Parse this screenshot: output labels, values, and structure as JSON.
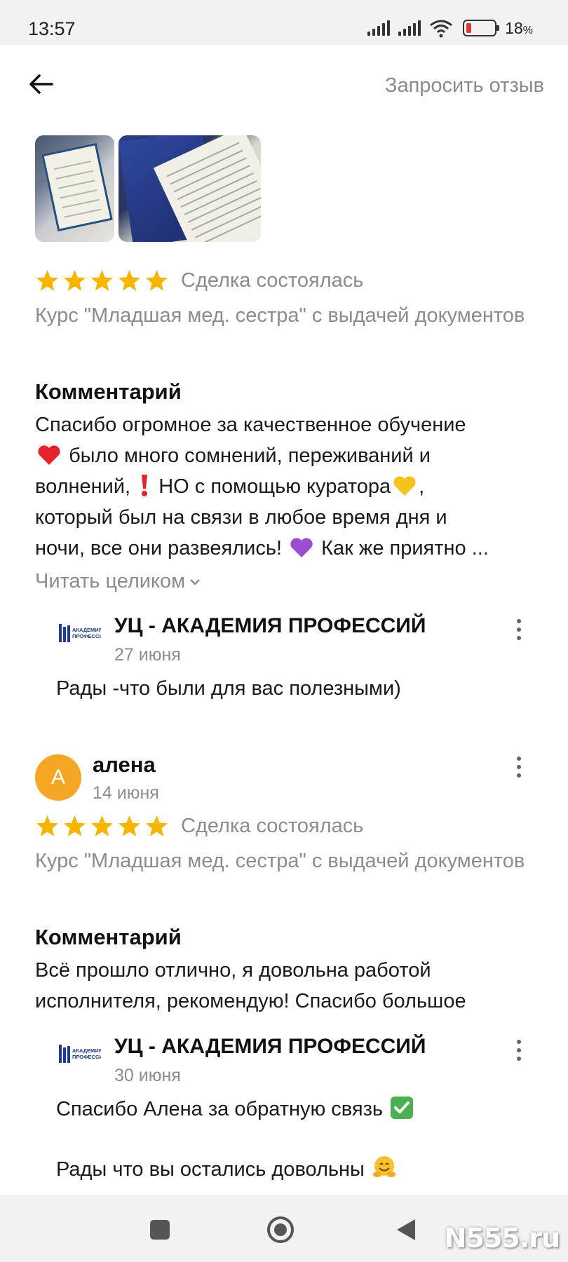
{
  "status_bar": {
    "time": "13:57",
    "battery_percent": 18,
    "battery_label": "18",
    "battery_unit": "%"
  },
  "header": {
    "request_review": "Запросить отзыв"
  },
  "reviews": [
    {
      "rating": 5,
      "deal_status": "Сделка состоялась",
      "course": "Курс \"Младшая мед. сестра\" с выдачей документов",
      "comment_heading": "Комментарий",
      "comment_lines": [
        "Спасибо огромное за качественное обучение",
        "было много сомнений, переживаний и",
        "волнений,",
        "НО с помощью куратора",
        ",",
        "который был на связи в любое время дня и",
        "ночи, все они развеялись!",
        "Как же приятно ..."
      ],
      "read_more": "Читать целиком",
      "reply": {
        "name": "УЦ -  АКАДЕМИЯ ПРОФЕССИЙ",
        "date": "27 июня",
        "text": "Рады -что были для вас полезными)"
      }
    },
    {
      "author": {
        "initial": "А",
        "name": "алена",
        "date": "14 июня"
      },
      "rating": 5,
      "deal_status": "Сделка состоялась",
      "course": "Курс \"Младшая мед. сестра\" с выдачей документов",
      "comment_heading": "Комментарий",
      "comment_lines": [
        "Всё прошло отлично, я довольна работой",
        "исполнителя, рекомендую! Спасибо большое"
      ],
      "reply": {
        "name": "УЦ -  АКАДЕМИЯ ПРОФЕССИЙ",
        "date": "30 июня",
        "text_line1": "Спасибо Алена за обратную связь",
        "text_line2": "Рады что вы остались довольны"
      }
    }
  ],
  "logo_text": {
    "line1": "АКАДЕМИЯ",
    "line2": "ПРОФЕССИЙ"
  },
  "watermark": "N555.ru",
  "colors": {
    "star": "#f7b500",
    "avatar": "#f5a623",
    "muted_text": "#8c8c8c",
    "battery_low": "#e53935"
  },
  "icons": [
    "back-arrow-icon",
    "star-icon",
    "kebab-menu-icon",
    "chevron-down-icon",
    "heart-emoji",
    "exclamation-emoji",
    "yellow-heart-emoji",
    "purple-heart-emoji",
    "check-mark-emoji",
    "hugging-face-emoji",
    "square-nav-icon",
    "circle-nav-icon",
    "triangle-nav-icon"
  ]
}
